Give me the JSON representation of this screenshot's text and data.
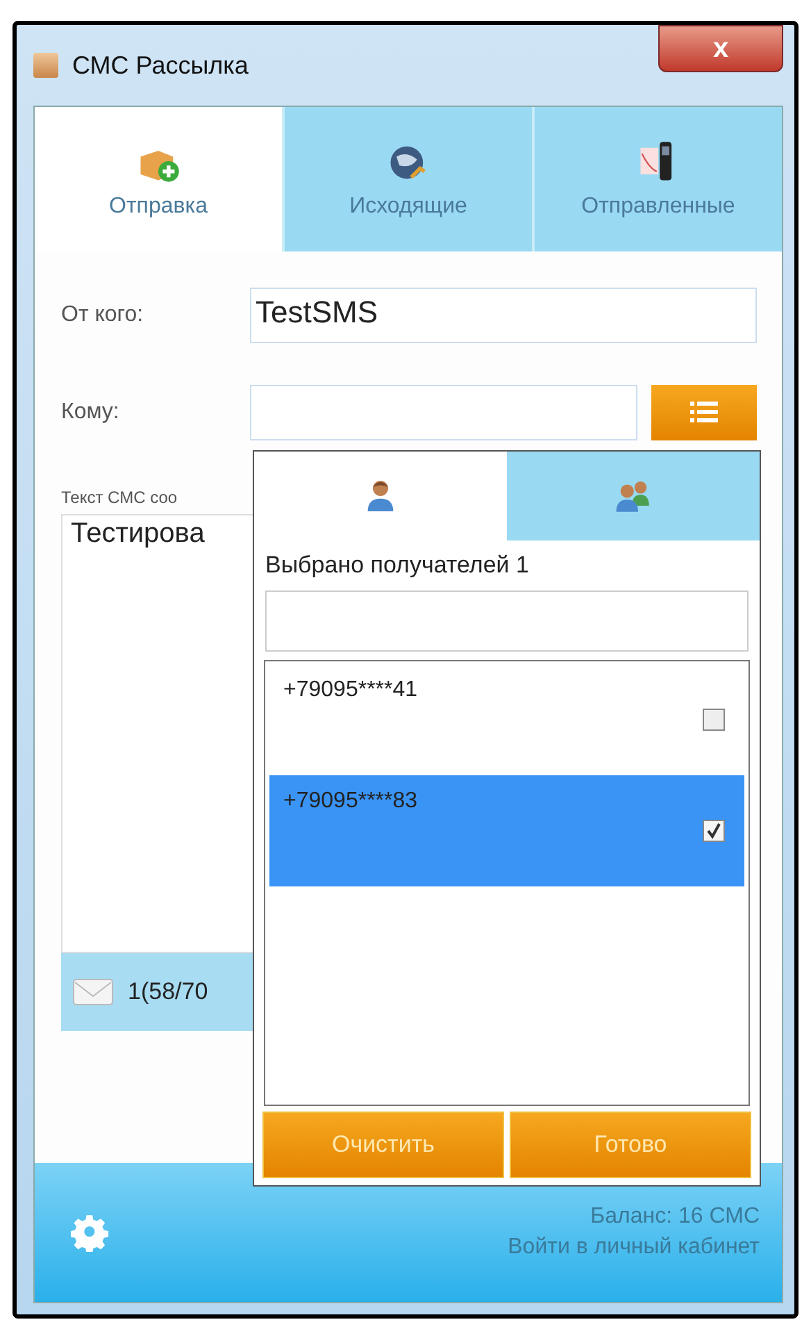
{
  "window": {
    "title": "СМС Рассылка",
    "close_label": "x"
  },
  "tabs": [
    {
      "label": "Отправка",
      "selected": true
    },
    {
      "label": "Исходящие",
      "selected": false
    },
    {
      "label": "Отправленные",
      "selected": false
    }
  ],
  "form": {
    "from_label": "От кого:",
    "from_value": "TestSMS",
    "to_label": "Кому:",
    "message_label": "Текст СМС соо",
    "message_value": "Тестирова",
    "counter": "1(58/70"
  },
  "popup": {
    "tabs": [
      {
        "selected": true
      },
      {
        "selected": false
      }
    ],
    "selected_count": "Выбрано получателей 1",
    "recipients": [
      {
        "number": "+79095****41",
        "checked": false,
        "selected": false
      },
      {
        "number": "+79095****83",
        "checked": true,
        "selected": true
      }
    ],
    "buttons": [
      "Очистить",
      "Готово"
    ]
  },
  "footer": {
    "balance": "Баланс: 16 СМС",
    "account_link": "Войти в личный кабинет"
  }
}
